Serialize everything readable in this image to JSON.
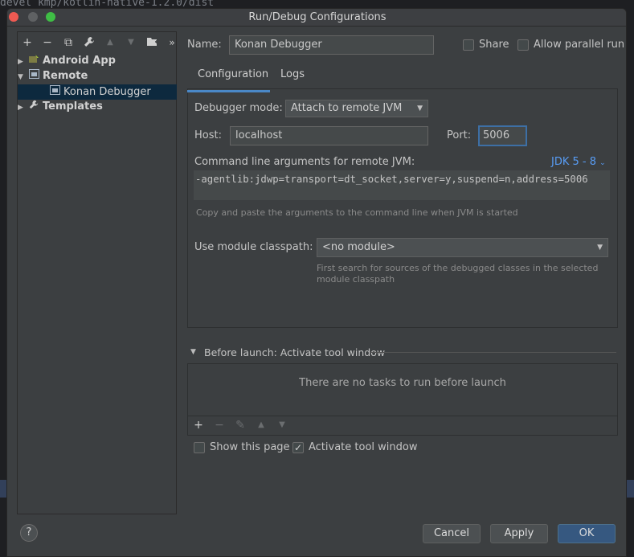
{
  "background": {
    "path_text": "devel kmp/kotlin-native-1.2.0/dist"
  },
  "window": {
    "title": "Run/Debug Configurations"
  },
  "toolbar": {
    "icons": [
      "plus-icon",
      "minus-icon",
      "copy-icon",
      "wrench-icon",
      "arrow-up-icon",
      "arrow-down-icon",
      "folder-add-icon",
      "more-icon"
    ],
    "add": "+",
    "remove": "−",
    "copy": "⧉",
    "edit": "🔧",
    "up": "▲",
    "down": "▼",
    "folder": "▇",
    "more": "»"
  },
  "tree": {
    "items": [
      {
        "label": "Android App",
        "expanded": false,
        "bold": true
      },
      {
        "label": "Remote",
        "expanded": true,
        "bold": true
      },
      {
        "label": "Konan Debugger",
        "child": true,
        "selected": true
      },
      {
        "label": "Templates",
        "expanded": false,
        "bold": true
      }
    ]
  },
  "form": {
    "name_label": "Name:",
    "name_value": "Konan Debugger",
    "share_label": "Share",
    "share_checked": false,
    "parallel_label": "Allow parallel run",
    "parallel_checked": false
  },
  "tabs": [
    {
      "label": "Configuration",
      "active": true
    },
    {
      "label": "Logs",
      "active": false
    }
  ],
  "config": {
    "debugger_mode_label": "Debugger mode:",
    "debugger_mode_value": "Attach to remote JVM",
    "host_label": "Host:",
    "host_value": "localhost",
    "port_label": "Port:",
    "port_value": "5006",
    "cmd_label": "Command line arguments for remote JVM:",
    "jdk_link": "JDK 5 - 8",
    "cmd_value": "-agentlib:jdwp=transport=dt_socket,server=y,suspend=n,address=5006",
    "cmd_hint": "Copy and paste the arguments to the command line when JVM is started",
    "module_label": "Use module classpath:",
    "module_value": "<no module>",
    "module_hint_1": "First search for sources of the debugged classes in the selected",
    "module_hint_2": "module classpath"
  },
  "before_launch": {
    "title": "Before launch: Activate tool window",
    "empty_text": "There are no tasks to run before launch",
    "toolbar": {
      "add": "+",
      "remove": "−",
      "edit": "✎",
      "up": "▲",
      "down": "▼"
    }
  },
  "options": {
    "show_page_label": "Show this page",
    "show_page_checked": false,
    "activate_label": "Activate tool window",
    "activate_checked": true
  },
  "buttons": {
    "help": "?",
    "cancel": "Cancel",
    "apply": "Apply",
    "ok": "OK"
  },
  "colors": {
    "accent": "#4a88c7",
    "link": "#589df6",
    "ok_button": "#365880",
    "selection": "#0d293e"
  }
}
